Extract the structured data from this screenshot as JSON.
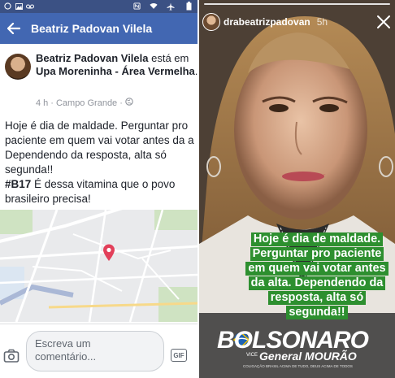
{
  "facebook": {
    "status_bar": {
      "icons": [
        "whatsapp-icon",
        "image-icon",
        "voicemail-icon",
        "nfc-icon",
        "wifi-icon",
        "airplane-icon",
        "battery-icon"
      ]
    },
    "appbar": {
      "title": "Beatriz Padovan Vilela",
      "color": "#4267b2"
    },
    "post": {
      "author": "Beatriz Padovan Vilela",
      "verb": " está em ",
      "place": "Upa Moreninha - Área Vermelha",
      "suffix": ".",
      "time": "4 h",
      "location": "Campo Grande",
      "lines": [
        "Hoje é dia de maldade. Perguntar pro",
        "paciente em quem vai votar antes da a",
        "Dependendo da resposta, alta só",
        "segunda!!"
      ],
      "hashtag": "#B17",
      "hashtag_rest": " É dessa vitamina que o povo",
      "last_line": "brasileiro precisa!"
    },
    "comment": {
      "placeholder_line1": "Escreva um",
      "placeholder_line2": "comentário...",
      "gif_label": "GIF"
    }
  },
  "instagram": {
    "username": "drabeatrizpadovan",
    "time": "5h",
    "caption_lines": [
      "Hoje é dia de maldade.",
      "Perguntar pro paciente",
      "em quem vai votar antes",
      "da alta. Dependendo da",
      "resposta, alta só",
      "segunda!!"
    ],
    "caption_color": "#2d8f2f",
    "logo": {
      "main": "BOLSONARO",
      "vice_label": "VICE",
      "vice_name": "General MOURÃO",
      "tiny": "COLIGAÇÃO BRASIL ACIMA DE TUDO, DEUS ACIMA DE TODOS"
    }
  }
}
